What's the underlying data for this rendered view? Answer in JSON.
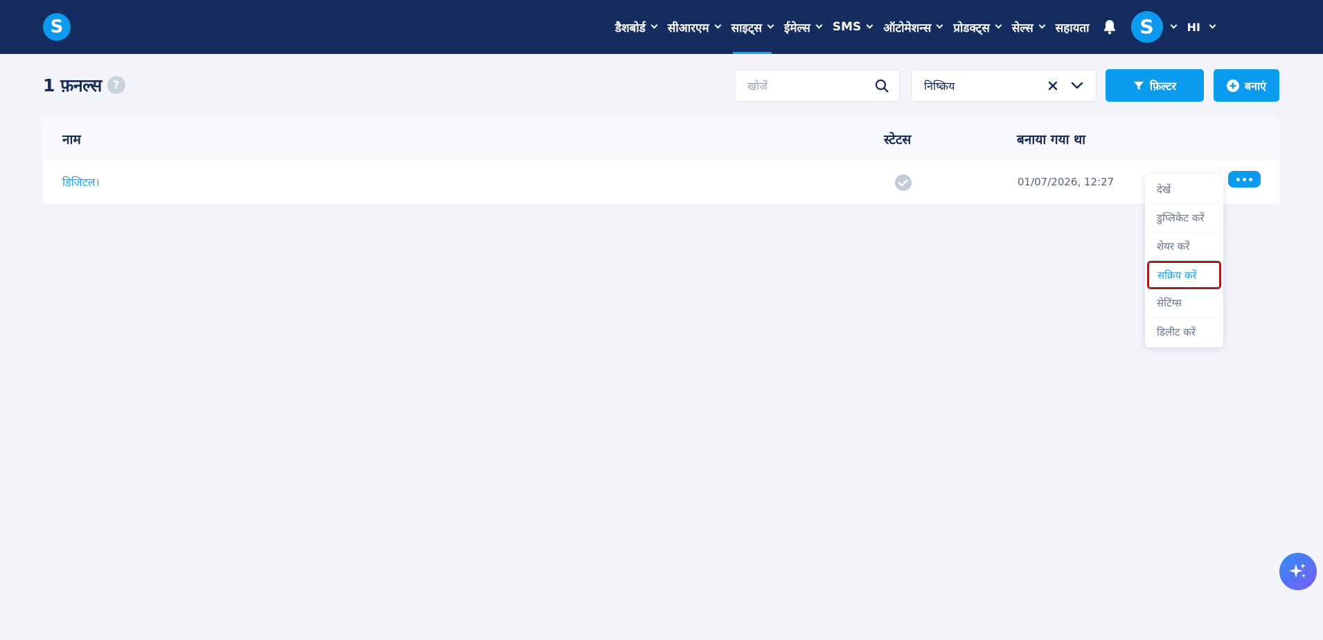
{
  "brand": {
    "logo_letter": "S"
  },
  "nav": {
    "items": [
      {
        "label": "डैशबोर्ड",
        "active": false
      },
      {
        "label": "सीआरएम",
        "active": false
      },
      {
        "label": "साइट्स",
        "active": true
      },
      {
        "label": "ईमेल्स",
        "active": false
      },
      {
        "label": "SMS",
        "active": false
      },
      {
        "label": "ऑटोमेशन्स",
        "active": false
      },
      {
        "label": "प्रोडक्ट्स",
        "active": false
      },
      {
        "label": "सेल्स",
        "active": false
      }
    ],
    "help_label": "सहायता",
    "avatar_letter": "S",
    "language": "HI",
    "icons": [
      "bell-icon",
      "chevron-down-icon"
    ]
  },
  "page": {
    "title": "1 फ़नल्स",
    "help_glyph": "?"
  },
  "toolbar": {
    "search_placeholder": "खोजें",
    "status_filter_value": "निष्क्रिय",
    "filter_label": "फ़िल्टर",
    "create_label": "बनाएं"
  },
  "table": {
    "columns": {
      "name": "नाम",
      "status": "स्टेटस",
      "created": "बनाया गया था"
    },
    "rows": [
      {
        "name": "डिजिटल।",
        "status_icon": "check-circle-icon",
        "created": "01/07/2026, 12:27"
      }
    ]
  },
  "row_menu": {
    "items": [
      {
        "label": "देखें",
        "highlighted": false
      },
      {
        "label": "डुप्लिकेट करें",
        "highlighted": false
      },
      {
        "label": "शेयर करें",
        "highlighted": false
      },
      {
        "label": "सक्रिय करें",
        "highlighted": true
      },
      {
        "label": "सेटिंग्स",
        "highlighted": false
      },
      {
        "label": "डिलीट करें",
        "highlighted": false
      }
    ]
  },
  "colors": {
    "topbar": "#152c60",
    "accent": "#0b9bef",
    "highlight_border": "#a11f1f"
  }
}
